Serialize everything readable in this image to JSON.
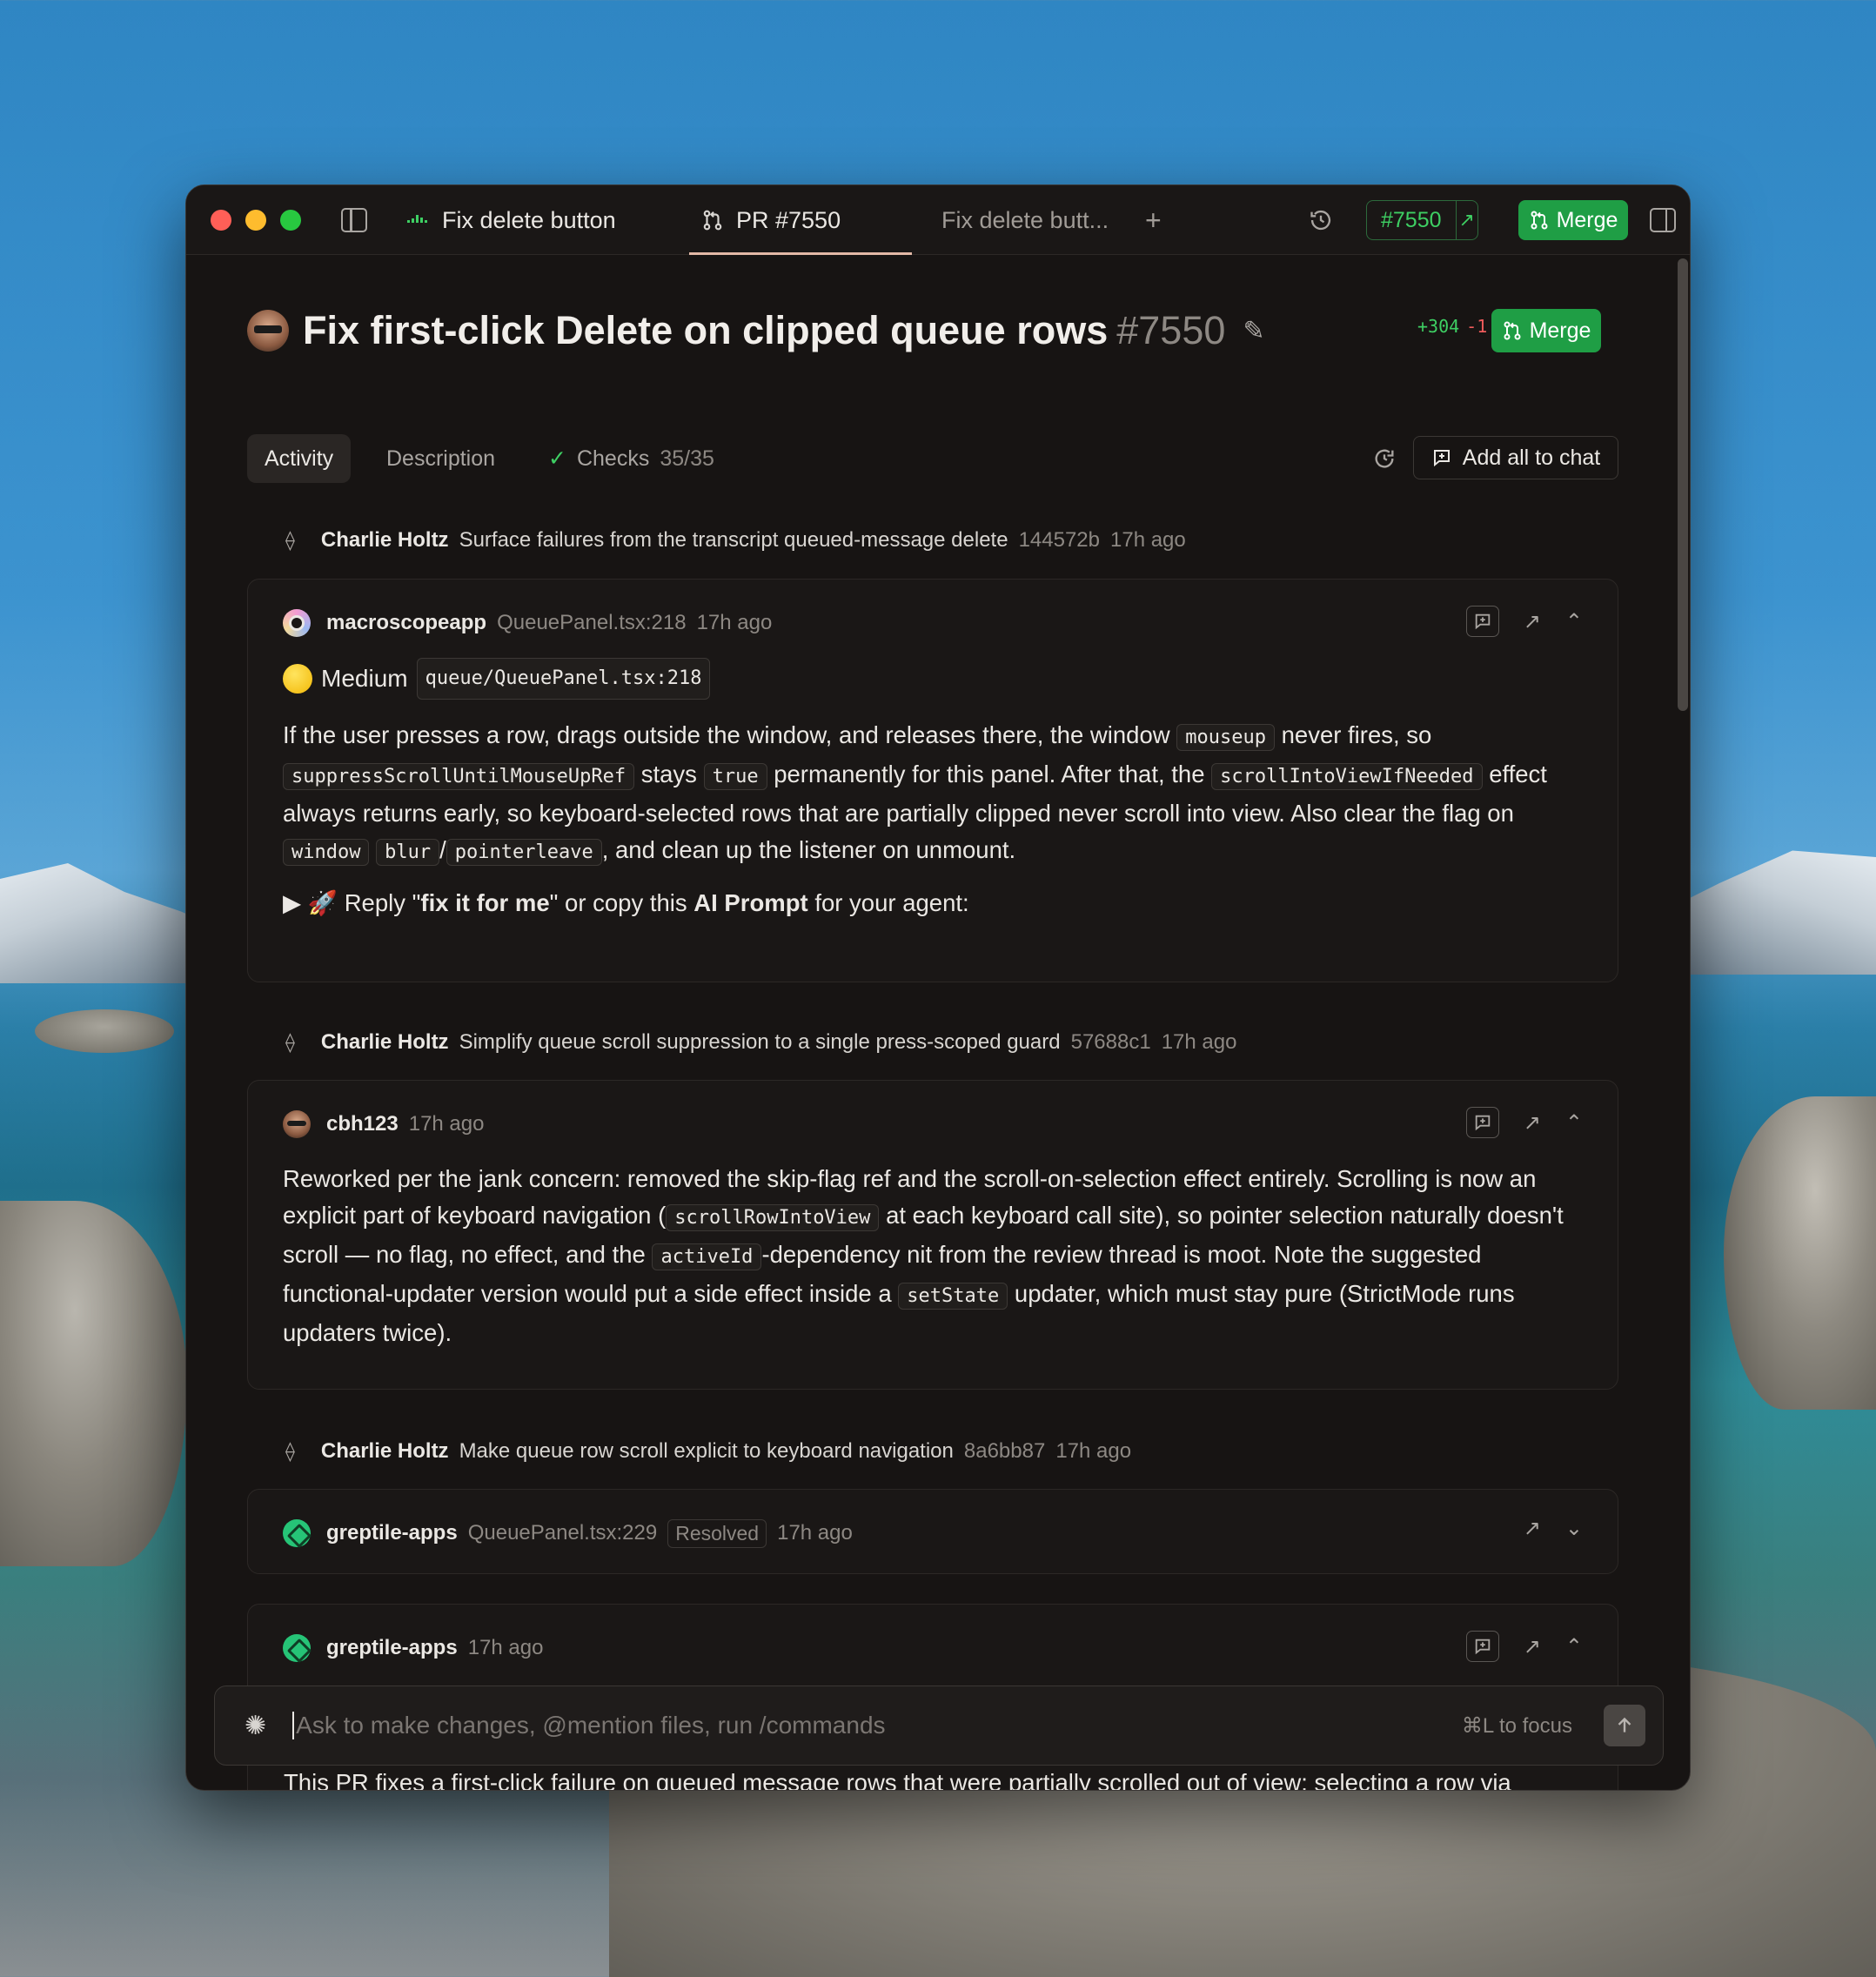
{
  "window": {
    "tabs": [
      {
        "label": "Fix delete button"
      },
      {
        "label": "PR #7550"
      },
      {
        "label": "Fix delete butt..."
      }
    ],
    "pr_pill": "#7550",
    "merge_label": "Merge"
  },
  "header": {
    "title": "Fix first-click Delete on clipped queue rows",
    "number": "#7550",
    "additions": "+304",
    "deletions": "-1",
    "merge_label": "Merge"
  },
  "page_tabs": {
    "activity": "Activity",
    "description": "Description",
    "checks": "Checks",
    "checks_count": "35/35",
    "add_all_to_chat": "Add all to chat"
  },
  "timeline": {
    "commit1": {
      "author": "Charlie Holtz",
      "message": "Surface failures from the transcript queued-message delete",
      "sha": "144572b",
      "time": "17h ago"
    },
    "comment1": {
      "author": "macroscopeapp",
      "location": "QueuePanel.tsx:218",
      "time": "17h ago",
      "severity": "Medium",
      "file": "queue/QueuePanel.tsx:218",
      "p1": "If the user presses a row, drags outside the window, and releases there, the window",
      "c1": "mouseup",
      "p2": "never fires, so",
      "c2": "suppressScrollUntilMouseUpRef",
      "p3": "stays",
      "c3": "true",
      "p4": "permanently for this panel. After that, the",
      "c4": "scrollIntoViewIfNeeded",
      "p5": "effect always returns early, so keyboard-selected rows that are partially clipped never scroll into view. Also clear the flag on",
      "c5": "window",
      "c6": "blur",
      "slash": "/",
      "c7": "pointerleave",
      "p6": ", and clean up the listener on unmount.",
      "reply_arrow": "▶",
      "reply_rocket": "🚀",
      "reply_a": "Reply \"",
      "reply_b": "fix it for me",
      "reply_c": "\" or copy this ",
      "reply_d": "AI Prompt",
      "reply_e": " for your agent:"
    },
    "commit2": {
      "author": "Charlie Holtz",
      "message": "Simplify queue scroll suppression to a single press-scoped guard",
      "sha": "57688c1",
      "time": "17h ago"
    },
    "comment2": {
      "author": "cbh123",
      "time": "17h ago",
      "p1": "Reworked per the jank concern: removed the skip-flag ref and the scroll-on-selection effect entirely. Scrolling is now an explicit part of keyboard navigation (",
      "c1": "scrollRowIntoView",
      "p2": "at each keyboard call site), so pointer selection naturally doesn't scroll — no flag, no effect, and the",
      "c2": "activeId",
      "p3": "-dependency nit from the review thread is moot. Note the suggested functional-updater version would put a side effect inside a",
      "c3": "setState",
      "p4": "updater, which must stay pure (StrictMode runs updaters twice)."
    },
    "commit3": {
      "author": "Charlie Holtz",
      "message": "Make queue row scroll explicit to keyboard navigation",
      "sha": "8a6bb87",
      "time": "17h ago"
    },
    "comment3": {
      "author": "greptile-apps",
      "location": "QueuePanel.tsx:229",
      "status": "Resolved",
      "time": "17h ago"
    },
    "comment4": {
      "author": "greptile-apps",
      "time": "17h ago"
    }
  },
  "composer": {
    "placeholder": "Ask to make changes, @mention files, run /commands",
    "hint": "⌘L to focus",
    "trailing_text": "This PR fixes a first-click failure on queued message rows that were partially scrolled out of view: selecting a row via"
  }
}
